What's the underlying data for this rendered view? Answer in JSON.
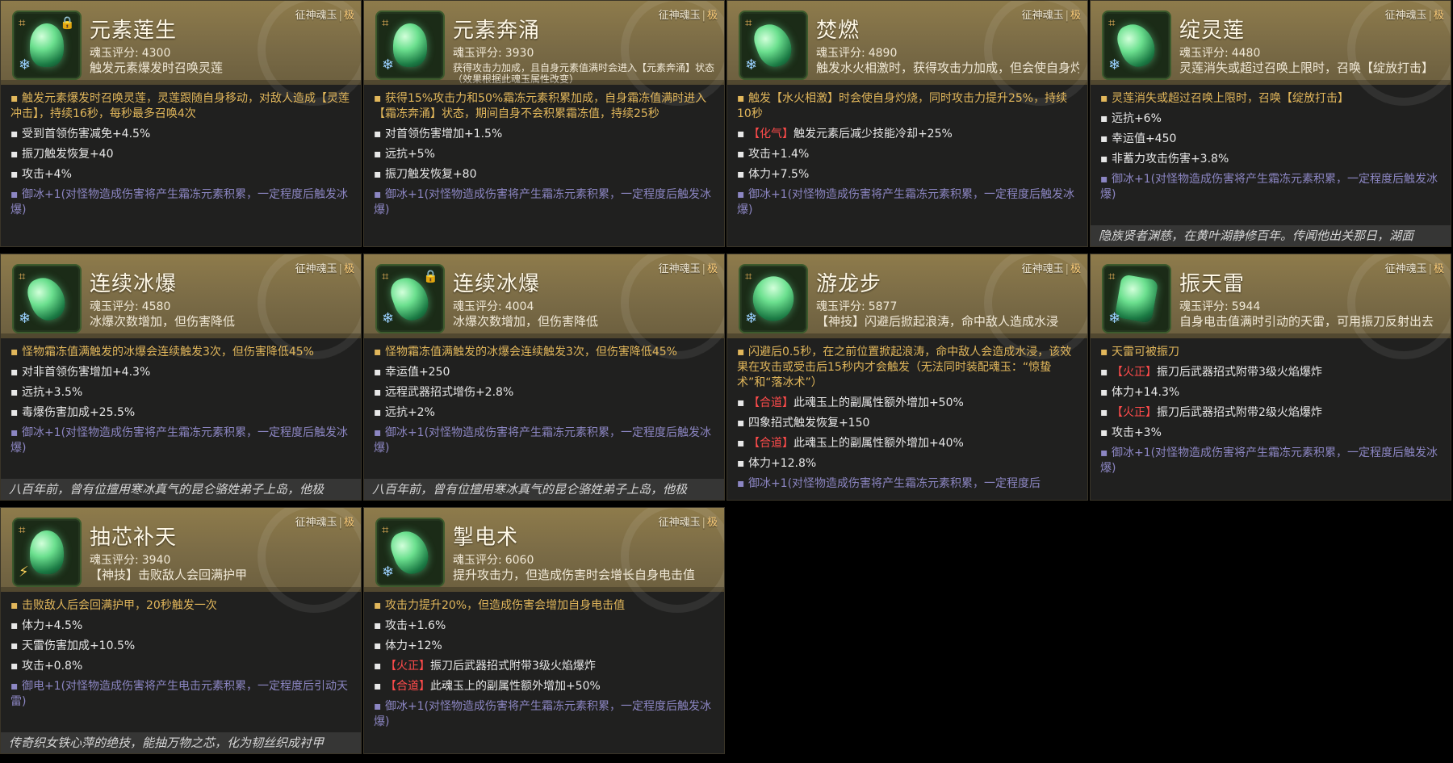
{
  "colors": {
    "header_gold": "#8e7b4b",
    "panel_bg": "#20201f",
    "main_effect": "#e2b75b",
    "bonus_effect": "#8c86c3",
    "red_tag": "#ff4b4b"
  },
  "ui": {
    "top_tag_prefix": "征神魂玉",
    "top_tag_sep": "|",
    "top_tag_rarity": "极",
    "score_label": "魂玉评分:"
  },
  "cards": [
    {
      "name": "元素莲生",
      "score": "4300",
      "summary": "触发元素爆发时召唤灵莲",
      "summary_small": false,
      "icon": "jade-flower-icon",
      "element_icon": "ice-snowflake-icon",
      "locked": true,
      "main": "触发元素爆发时召唤灵莲，灵莲跟随自身移动，对敌人造成【灵莲冲击】，持续16秒，每秒最多召唤4次",
      "attrs": [
        "受到首领伤害减免+4.5%",
        "振刀触发恢复+40",
        "攻击+4%"
      ],
      "bonus": "御冰+1(对怪物造成伤害将产生霜冻元素积累，一定程度后触发冰爆)",
      "footer": "",
      "has_footer": false
    },
    {
      "name": "元素奔涌",
      "score": "3930",
      "summary": "获得攻击力加成，且自身元素值满时会进入【元素奔涌】状态（效果根据此魂玉属性改变）",
      "summary_small": true,
      "icon": "jade-flower-icon",
      "element_icon": "ice-snowflake-icon",
      "locked": false,
      "main": "获得15%攻击力和50%霜冻元素积累加成，自身霜冻值满时进入【霜冻奔涌】状态，期间自身不会积累霜冻值，持续25秒",
      "attrs": [
        "对首领伤害增加+1.5%",
        "远抗+5%",
        "振刀触发恢复+80"
      ],
      "bonus": "御冰+1(对怪物造成伤害将产生霜冻元素积累，一定程度后触发冰爆)",
      "footer": "",
      "has_footer": false
    },
    {
      "name": "焚燃",
      "score": "4890",
      "summary": "触发水火相激时，获得攻击力加成，但会使自身灼烧",
      "summary_small": false,
      "icon": "jade-dragon-icon",
      "element_icon": "ice-snowflake-icon",
      "locked": false,
      "main": "触发【水火相激】时会使自身灼烧，同时攻击力提升25%，持续10秒",
      "attrs_rich": [
        {
          "tag": "【化气】",
          "text": "触发元素后减少技能冷却+25%"
        },
        {
          "tag": "",
          "text": "攻击+1.4%"
        },
        {
          "tag": "",
          "text": "体力+7.5%"
        }
      ],
      "bonus": "御冰+1(对怪物造成伤害将产生霜冻元素积累，一定程度后触发冰爆)",
      "footer": "",
      "has_footer": false
    },
    {
      "name": "绽灵莲",
      "score": "4480",
      "summary": "灵莲消失或超过召唤上限时，召唤【绽放打击】",
      "summary_small": false,
      "icon": "jade-dragon-icon",
      "element_icon": "ice-snowflake-icon",
      "locked": false,
      "main": "灵莲消失或超过召唤上限时，召唤【绽放打击】",
      "attrs": [
        "远抗+6%",
        "幸运值+450",
        "非蓄力攻击伤害+3.8%"
      ],
      "bonus": "御冰+1(对怪物造成伤害将产生霜冻元素积累，一定程度后触发冰爆)",
      "footer": "隐族贤者渊慈，在黄叶湖静修百年。传闻他出关那日，湖面",
      "has_footer": true
    },
    {
      "name": "连续冰爆",
      "score": "4580",
      "summary": "冰爆次数增加，但伤害降低",
      "summary_small": false,
      "icon": "jade-dragon-icon",
      "element_icon": "ice-snowflake-icon",
      "locked": false,
      "main": "怪物霜冻值满触发的冰爆会连续触发3次，但伤害降低45%",
      "attrs": [
        "对非首领伤害增加+4.3%",
        "远抗+3.5%",
        "毒爆伤害加成+25.5%"
      ],
      "bonus": "御冰+1(对怪物造成伤害将产生霜冻元素积累，一定程度后触发冰爆)",
      "footer": "八百年前，曾有位擅用寒冰真气的昆仑骆姓弟子上岛，他极",
      "has_footer": true
    },
    {
      "name": "连续冰爆",
      "score": "4004",
      "summary": "冰爆次数增加，但伤害降低",
      "summary_small": false,
      "icon": "jade-dragon-icon",
      "element_icon": "ice-snowflake-icon",
      "locked": true,
      "main": "怪物霜冻值满触发的冰爆会连续触发3次，但伤害降低45%",
      "attrs": [
        "幸运值+250",
        "远程武器招式增伤+2.8%",
        "远抗+2%"
      ],
      "bonus": "御冰+1(对怪物造成伤害将产生霜冻元素积累，一定程度后触发冰爆)",
      "footer": "八百年前，曾有位擅用寒冰真气的昆仑骆姓弟子上岛，他极",
      "has_footer": true
    },
    {
      "name": "游龙步",
      "score": "5877",
      "summary": "【神技】闪避后掀起浪涛，命中敌人造成水浸",
      "summary_small": false,
      "icon": "jade-leaf-icon",
      "element_icon": "ice-snowflake-icon",
      "locked": false,
      "main": "闪避后0.5秒，在之前位置掀起浪涛，命中敌人会造成水浸，该效果在攻击或受击后15秒内才会触发（无法同时装配魂玉：“惊蛰术”和“落冰术”）",
      "attrs_rich": [
        {
          "tag": "【合道】",
          "text": "此魂玉上的副属性额外增加+50%"
        },
        {
          "tag": "",
          "text": "四象招式触发恢复+150"
        },
        {
          "tag": "【合道】",
          "text": "此魂玉上的副属性额外增加+40%"
        },
        {
          "tag": "",
          "text": "体力+12.8%"
        }
      ],
      "bonus": "御冰+1(对怪物造成伤害将产生霜冻元素积累，一定程度后",
      "footer": "",
      "has_footer": false
    },
    {
      "name": "振天雷",
      "score": "5944",
      "summary": "自身电击值满时引动的天雷，可用振刀反射出去",
      "summary_small": false,
      "icon": "jade-block-icon",
      "element_icon": "ice-snowflake-icon",
      "locked": false,
      "main": "天雷可被振刀",
      "attrs_rich": [
        {
          "tag": "【火正】",
          "text": "振刀后武器招式附带3级火焰爆炸"
        },
        {
          "tag": "",
          "text": "体力+14.3%"
        },
        {
          "tag": "【火正】",
          "text": "振刀后武器招式附带2级火焰爆炸"
        },
        {
          "tag": "",
          "text": "攻击+3%"
        }
      ],
      "bonus": "御冰+1(对怪物造成伤害将产生霜冻元素积累，一定程度后触发冰爆)",
      "footer": "",
      "has_footer": false
    },
    {
      "name": "抽芯补天",
      "score": "3940",
      "summary": "【神技】击败敌人会回满护甲",
      "summary_small": false,
      "icon": "jade-flower-icon",
      "element_icon": "lightning-icon",
      "locked": false,
      "main": "击败敌人后会回满护甲，20秒触发一次",
      "attrs": [
        "体力+4.5%",
        "天雷伤害加成+10.5%",
        "攻击+0.8%"
      ],
      "bonus": "御电+1(对怪物造成伤害将产生电击元素积累，一定程度后引动天雷)",
      "footer": "传奇织女铁心萍的绝技，能抽万物之芯，化为韧丝织成衬甲",
      "has_footer": true
    },
    {
      "name": "掣电术",
      "score": "6060",
      "summary": "提升攻击力，但造成伤害时会增长自身电击值",
      "summary_small": false,
      "icon": "jade-dragon-icon",
      "element_icon": "ice-snowflake-icon",
      "locked": false,
      "main": "攻击力提升20%，但造成伤害会增加自身电击值",
      "attrs_rich": [
        {
          "tag": "",
          "text": "攻击+1.6%"
        },
        {
          "tag": "",
          "text": "体力+12%"
        },
        {
          "tag": "【火正】",
          "text": "振刀后武器招式附带3级火焰爆炸"
        },
        {
          "tag": "【合道】",
          "text": "此魂玉上的副属性额外增加+50%"
        }
      ],
      "bonus": "御冰+1(对怪物造成伤害将产生霜冻元素积累，一定程度后触发冰爆)",
      "footer": "",
      "has_footer": false
    }
  ]
}
